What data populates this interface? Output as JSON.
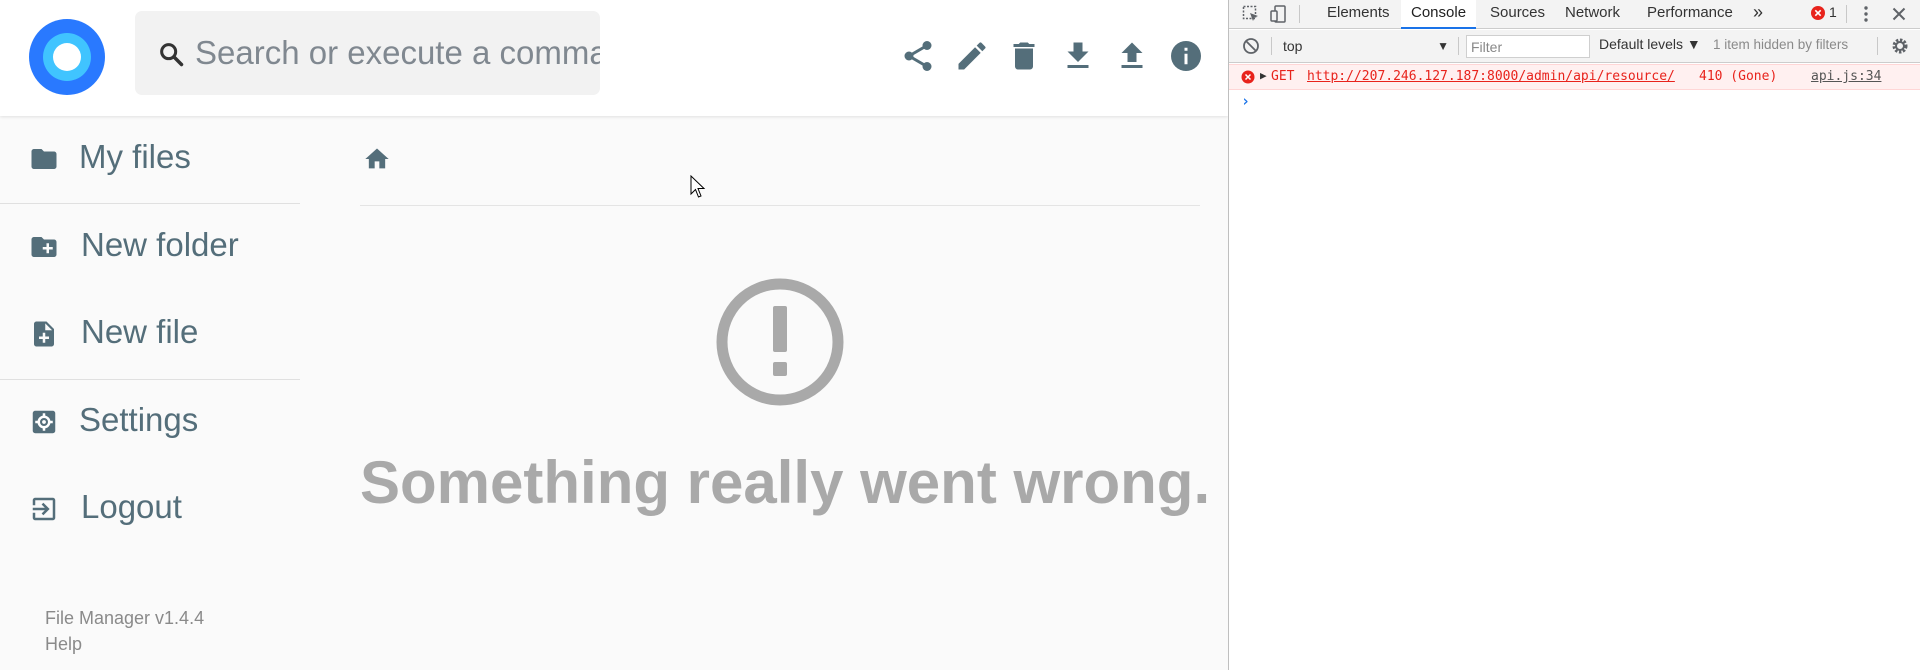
{
  "header": {
    "search_placeholder": "Search or execute a command...",
    "toolbar": [
      {
        "name": "share-button",
        "icon": "share-icon"
      },
      {
        "name": "rename-button",
        "icon": "pencil-icon"
      },
      {
        "name": "delete-button",
        "icon": "trash-icon"
      },
      {
        "name": "download-button",
        "icon": "download-icon"
      },
      {
        "name": "upload-button",
        "icon": "upload-icon"
      },
      {
        "name": "info-button",
        "icon": "info-icon"
      }
    ]
  },
  "sidebar": {
    "items": [
      {
        "label": "My files",
        "icon": "folder-icon"
      },
      {
        "label": "New folder",
        "icon": "new-folder-icon"
      },
      {
        "label": "New file",
        "icon": "new-file-icon"
      },
      {
        "label": "Settings",
        "icon": "settings-icon"
      },
      {
        "label": "Logout",
        "icon": "logout-icon"
      }
    ],
    "footer": {
      "version": "File Manager v1.4.4",
      "help": "Help"
    }
  },
  "main": {
    "breadcrumb_icon": "home-icon",
    "error_icon": "exclamation-circle-icon",
    "error_message": "Something really went wrong."
  },
  "devtools": {
    "tabs": [
      "Elements",
      "Console",
      "Sources",
      "Network",
      "Performance"
    ],
    "active_tab": "Console",
    "more_tabs": "»",
    "error_count": "1",
    "context": "top",
    "filter_placeholder": "Filter",
    "levels": "Default levels ▼",
    "hidden_note": "1 item hidden by filters",
    "console": {
      "method": "GET",
      "url": "http://207.246.127.187:8000/admin/api/resource/",
      "status": "410 (Gone)",
      "source": "api.js:34",
      "prompt": "›"
    }
  },
  "colors": {
    "accent": "#2979ff",
    "nav_text": "#546e7a",
    "error_grey": "#a9a9a9",
    "console_error": "#e8231c",
    "devtools_active": "#1a73e8"
  }
}
